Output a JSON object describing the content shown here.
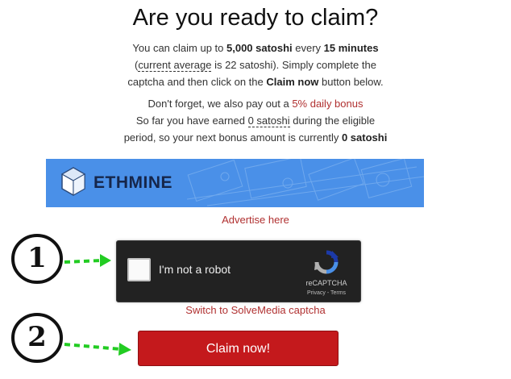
{
  "title": "Are you ready to claim?",
  "intro": {
    "t1": "You can claim up to ",
    "amount": "5,000 satoshi",
    "t2": " every ",
    "interval": "15 minutes",
    "t3": "(",
    "current_average": "current average",
    "t4": " is 22 satoshi). Simply complete the",
    "t5": "captcha and then click on the ",
    "claim_now_word": "Claim now",
    "t6": " button below."
  },
  "bonus": {
    "t1": "Don't forget, we also pay out a ",
    "daily_bonus_link": "5% daily bonus",
    "t2": "So far you have earned ",
    "earned": "0 satoshi",
    "t3": " during the eligible",
    "t4": "period, so your next bonus amount is currently ",
    "next_bonus": "0 satoshi"
  },
  "banner": {
    "text": "ETHMINE",
    "color": "#4a90e8"
  },
  "advertise_link": "Advertise here",
  "recaptcha": {
    "label": "I'm not a robot",
    "brand": "reCAPTCHA",
    "privacy": "Privacy",
    "separator": " - ",
    "terms": "Terms",
    "checked": false
  },
  "switch_captcha_link": "Switch to SolveMedia captcha",
  "claim_button": "Claim now!",
  "step_markers": [
    "1",
    "2"
  ],
  "colors": {
    "accent_red": "#c4191c",
    "link_red": "#b03030",
    "arrow_green": "#22cc22"
  }
}
